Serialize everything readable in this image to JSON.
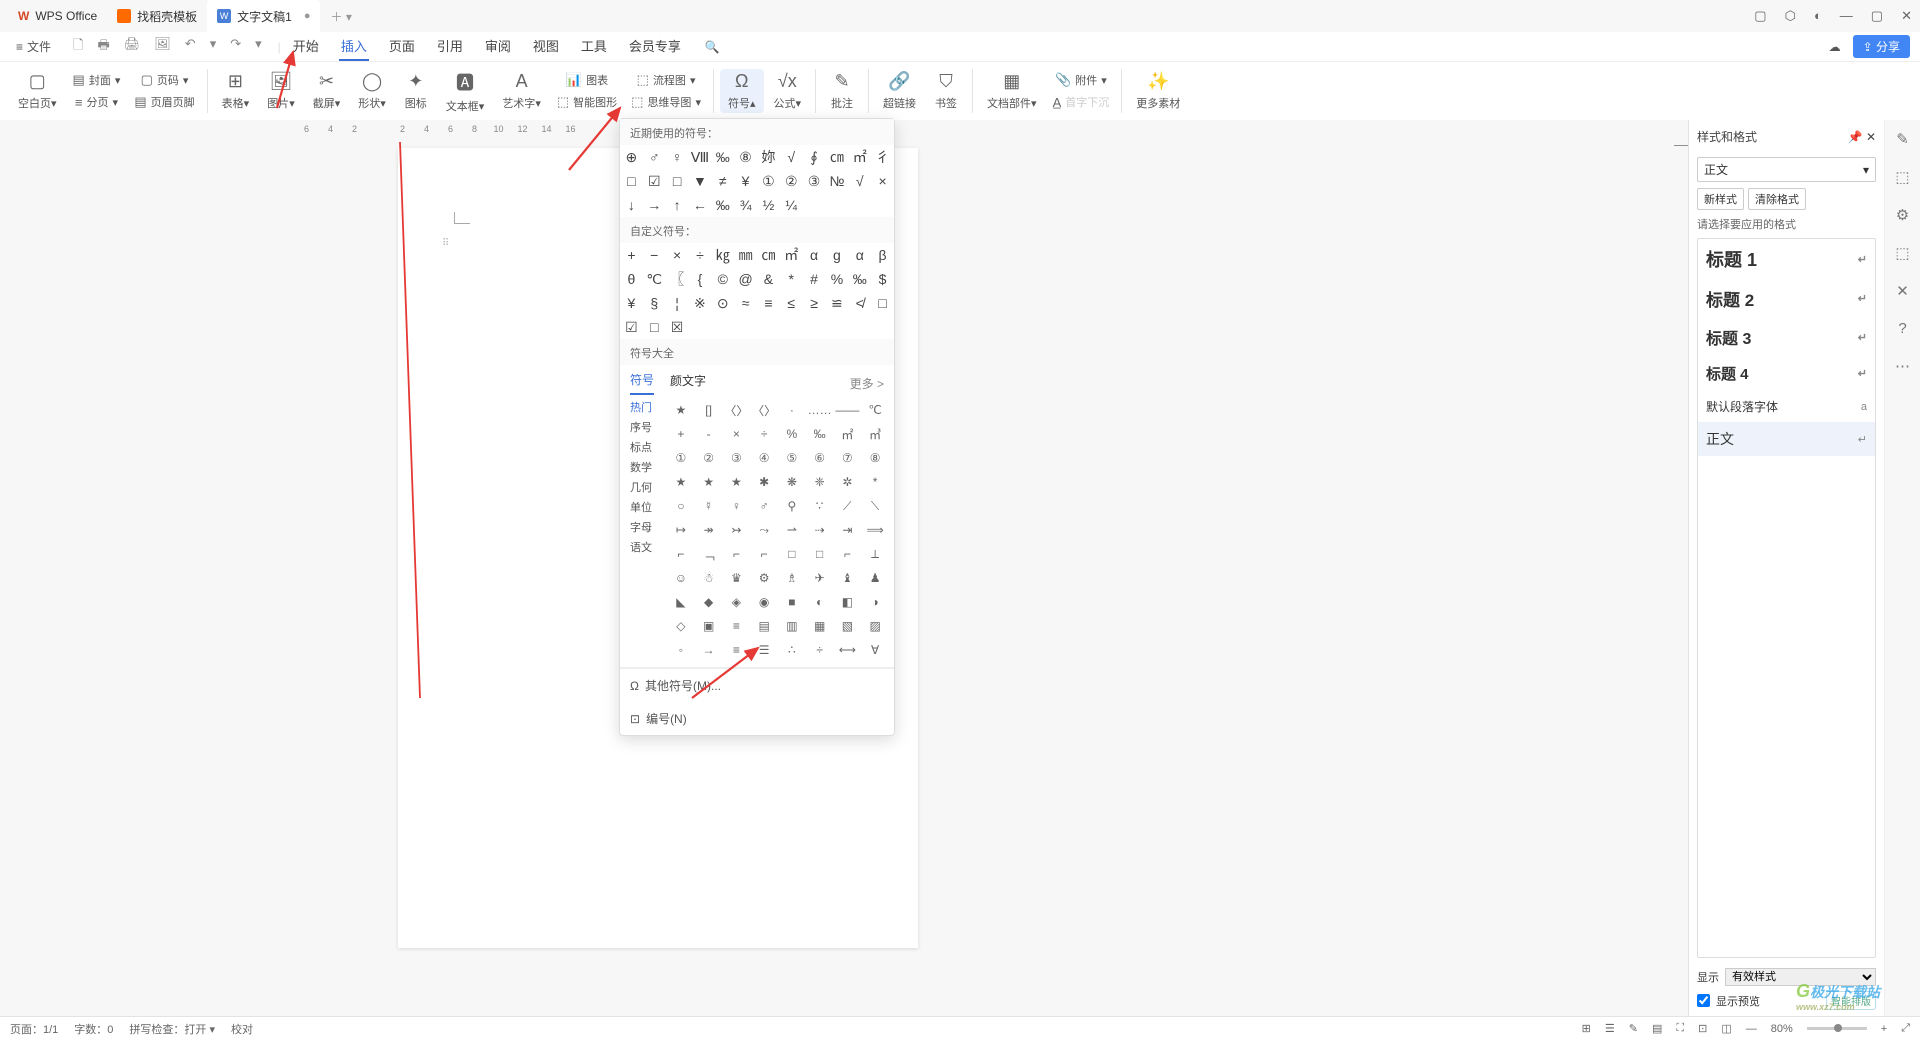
{
  "titlebar": {
    "tab1": "WPS Office",
    "tab2": "找稻壳模板",
    "tab3": "文字文稿1",
    "tab3_logo": "W",
    "win_icons": [
      "▢",
      "⬡",
      "◐",
      "—",
      "▢",
      "✕"
    ]
  },
  "menurow": {
    "file": "文件",
    "qat_icons": [
      "🗋",
      "🖶",
      "🖨",
      "🖼",
      "↶",
      "↷"
    ],
    "tabs": [
      "开始",
      "插入",
      "页面",
      "引用",
      "审阅",
      "视图",
      "工具",
      "会员专享"
    ],
    "active_tab_index": 1,
    "search_icon": "🔍",
    "cloud_icon": "☁",
    "share": "分享"
  },
  "ribbon": {
    "blank": "空白页",
    "cover": "封面",
    "pagenum": "页码",
    "section": "分页",
    "header": "页眉页脚",
    "table": "表格",
    "image": "图片",
    "screenshot": "截屏",
    "shape": "形状",
    "icon": "图标",
    "textbox": "文本框",
    "wordart": "艺术字",
    "chart": "图表",
    "smartart": "智能图形",
    "flowchart": "流程图",
    "mindmap": "思维导图",
    "symbol": "符号",
    "formula": "公式",
    "annotation": "批注",
    "hyperlink": "超链接",
    "bookmark": "书签",
    "docparts": "文档部件",
    "attachment": "附件",
    "nosink": "首字下沉",
    "more": "更多素材"
  },
  "ruler": [
    "6",
    "4",
    "2",
    "",
    "2",
    "4",
    "6",
    "8",
    "10",
    "12",
    "14",
    "16"
  ],
  "dropdown": {
    "recent_title": "近期使用的符号：",
    "recent_rows": [
      [
        "⊕",
        "♂",
        "♀",
        "Ⅷ",
        "‰",
        "⑧",
        "妳",
        "√",
        "∮",
        "㎝",
        "㎡",
        "彳"
      ],
      [
        "□",
        "☑",
        "□",
        "▼",
        "≠",
        "¥",
        "①",
        "②",
        "③",
        "№",
        "√",
        "×"
      ],
      [
        "↓",
        "→",
        "↑",
        "←",
        "‰",
        "¾",
        "½",
        "¼",
        "",
        "",
        "",
        ""
      ]
    ],
    "custom_title": "自定义符号：",
    "custom_rows": [
      [
        "+",
        "−",
        "×",
        "÷",
        "㎏",
        "㎜",
        "㎝",
        "㎡",
        "α",
        "g",
        "α",
        "β"
      ],
      [
        "θ",
        "℃",
        "〖",
        "{",
        "©",
        "@",
        "&",
        "*",
        "#",
        "%",
        "‰"
      ],
      [
        "$",
        "¥",
        "§",
        "¦",
        "※",
        "⊙",
        "≈",
        "≡",
        "≤",
        "≥",
        "≌",
        "≮"
      ],
      [
        "□",
        "☑",
        "□",
        "☒",
        "",
        "",
        "",
        "",
        "",
        "",
        "",
        ""
      ]
    ],
    "all_title": "符号大全",
    "tabs": [
      "符号",
      "颜文字"
    ],
    "more": "更多 >",
    "categories": [
      "热门",
      "序号",
      "标点",
      "数学",
      "几何",
      "单位",
      "字母",
      "语文"
    ],
    "browse_rows": [
      [
        "★",
        "[]",
        "〈〉",
        "〈〉",
        "·",
        "……",
        "——",
        "℃"
      ],
      [
        "+",
        "-",
        "×",
        "÷",
        "%",
        "‰",
        "㎡",
        "㎥"
      ],
      [
        "①",
        "②",
        "③",
        "④",
        "⑤",
        "⑥",
        "⑦",
        "⑧"
      ],
      [
        "★",
        "★",
        "★",
        "✱",
        "❋",
        "❈",
        "✲",
        "*"
      ],
      [
        "○",
        "☿",
        "♀",
        "♂",
        "⚲",
        "∵",
        "⟋",
        "⟍"
      ],
      [
        "↦",
        "↠",
        "↣",
        "⤳",
        "⇀",
        "⇢",
        "⇥",
        "⟹"
      ],
      [
        "⌐",
        "﹁",
        "⌐",
        "⌐",
        "□",
        "□",
        "⌐",
        "⟂"
      ],
      [
        "☺",
        "☃",
        "♛",
        "⚙",
        "♗",
        "✈",
        "♝",
        "♟"
      ],
      [
        "◣",
        "◆",
        "◈",
        "◉",
        "■",
        "◐",
        "◧",
        "◑"
      ],
      [
        "◇",
        "▣",
        "≡",
        "▤",
        "▥",
        "▦",
        "▧",
        "▨"
      ],
      [
        "◦",
        "→",
        "≡",
        "☰",
        "∴",
        "÷",
        "⟷",
        "∀"
      ]
    ],
    "footer_other": "其他符号(M)...",
    "footer_num": "编号(N)"
  },
  "styles_panel": {
    "title": "样式和格式",
    "current": "正文",
    "new_style": "新样式",
    "clear": "清除格式",
    "hint": "请选择要应用的格式",
    "items": [
      "标题 1",
      "标题 2",
      "标题 3",
      "标题 4",
      "默认段落字体",
      "正文"
    ],
    "show_label": "显示",
    "show_value": "有效样式",
    "preview": "显示预览",
    "smart": "智能排版"
  },
  "side_rail": [
    "✎",
    "⬚",
    "⚙",
    "⬚",
    "✕",
    "?",
    "⋯"
  ],
  "statusbar": {
    "page": "页面：1/1",
    "words": "字数：0",
    "spell": "拼写检查：打开",
    "proof": "校对",
    "zoom": "80%",
    "right_icons": [
      "⊞",
      "☰",
      "✎",
      "▤",
      "⛶",
      "⊡",
      "◫",
      "—",
      "+",
      "⤢"
    ]
  },
  "watermark": {
    "brand": "极光下载站",
    "url": "www.xz7.com"
  }
}
